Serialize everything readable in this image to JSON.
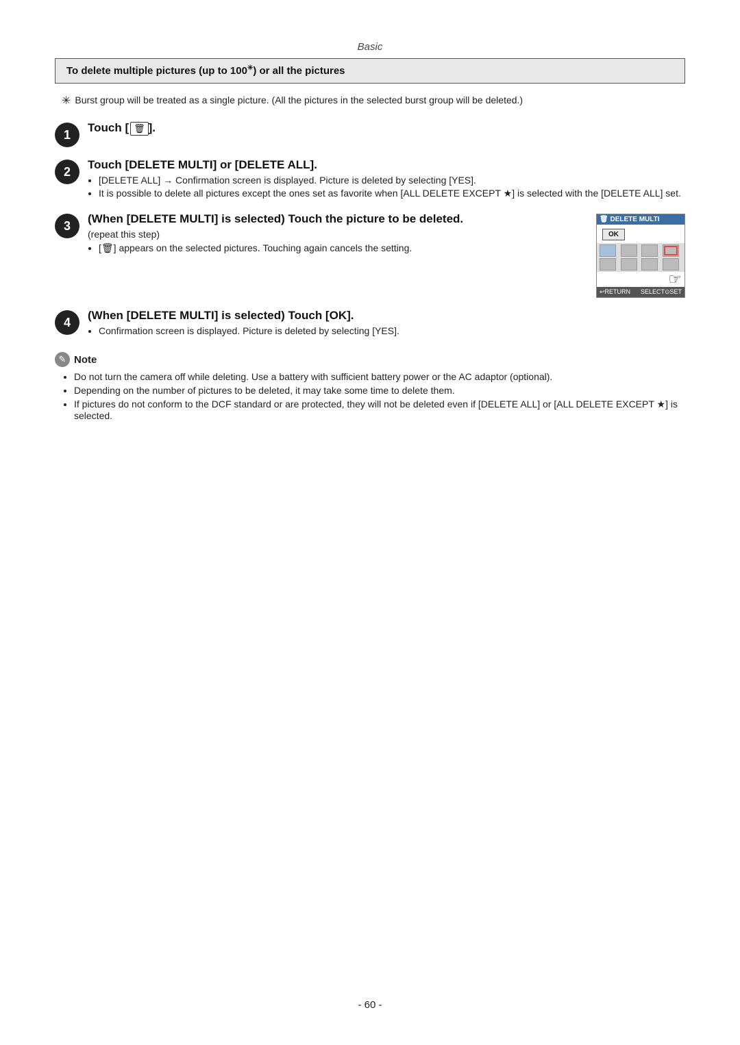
{
  "page": {
    "number": "- 60 -",
    "section_label": "Basic"
  },
  "header": {
    "text": "To delete multiple pictures (up to 100",
    "superscript": "※",
    "text_suffix": ") or all the pictures"
  },
  "asterisk_note": {
    "symbol": "✳",
    "text": "Burst group will be treated as a single picture. (All the pictures in the selected burst group will be deleted.)"
  },
  "steps": [
    {
      "number": "1",
      "title_pre": "Touch [",
      "title_icon": "🗑",
      "title_post": "]."
    },
    {
      "number": "2",
      "title": "Touch [DELETE MULTI] or [DELETE ALL].",
      "bullets": [
        "[DELETE ALL] → Confirmation screen is displayed. Picture is deleted by selecting [YES].",
        "It is possible to delete all pictures except the ones set as favorite when [ALL DELETE EXCEPT ★] is selected with the [DELETE ALL] set."
      ]
    },
    {
      "number": "3",
      "title": "(When [DELETE MULTI] is selected) Touch the picture to be deleted.",
      "repeat_label": "(repeat this step)",
      "sub_bullet": "[🗑] appears on the selected pictures. Touching again cancels the setting.",
      "preview_title": "DELETE MULTI"
    },
    {
      "number": "4",
      "title": "(When [DELETE MULTI] is selected) Touch [OK].",
      "bullets": [
        "Confirmation screen is displayed. Picture is deleted by selecting [YES]."
      ]
    }
  ],
  "note": {
    "label": "Note",
    "bullets": [
      "Do not turn the camera off while deleting. Use a battery with sufficient battery power or the AC adaptor (optional).",
      "Depending on the number of pictures to be deleted, it may take some time to delete them.",
      "If pictures do not conform to the DCF standard or are protected, they will not be deleted even if [DELETE ALL] or [ALL DELETE EXCEPT ★] is selected."
    ]
  }
}
